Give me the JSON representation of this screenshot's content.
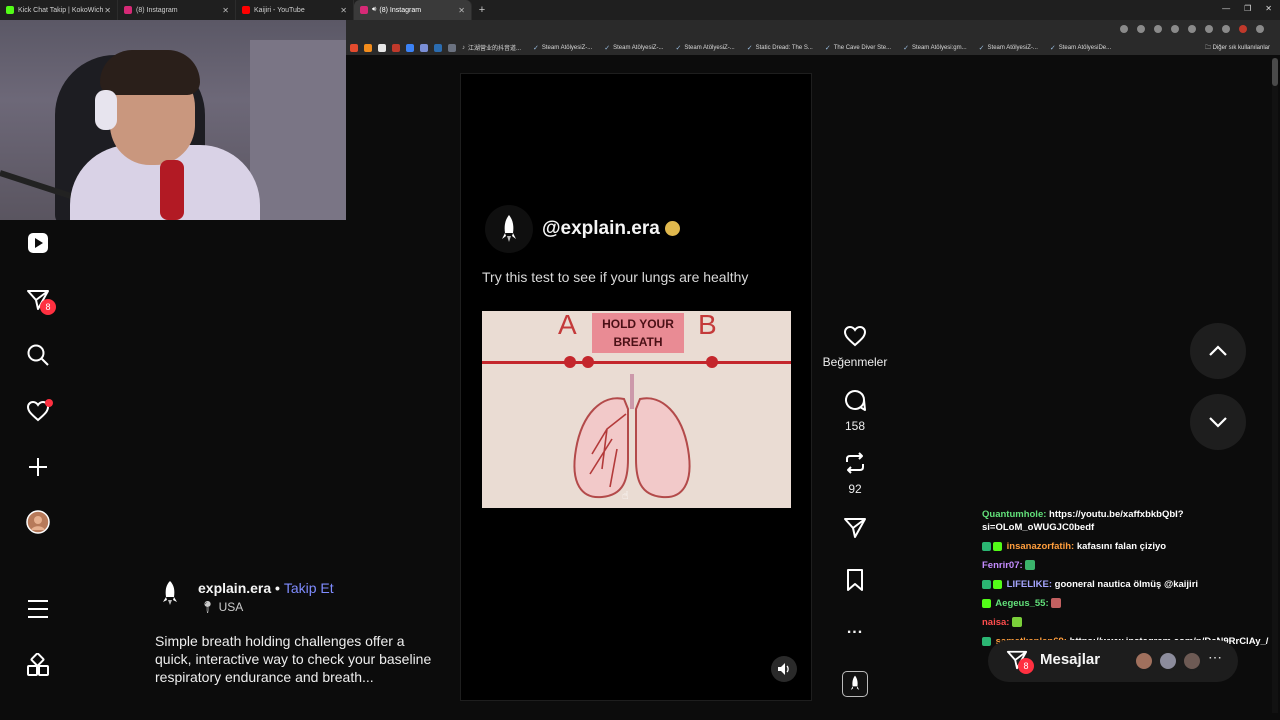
{
  "browser": {
    "tabs": [
      {
        "label": "Kick Chat Takip | KokoWich",
        "active": false,
        "fav_color": "#53fc18"
      },
      {
        "label": "(8) Instagram",
        "active": false,
        "fav_color": "#d62976"
      },
      {
        "label": "Kaijiri - YouTube",
        "active": false,
        "fav_color": "#ff0000"
      },
      {
        "label": "(8) Instagram",
        "active": true,
        "fav_color": "#d62976"
      }
    ],
    "new_tab_glyph": "+",
    "bookmarks": [
      "江湖营业的抖音道...",
      "Steam AtölyesiZ-...",
      "Steam AtölyesiZ-...",
      "Steam AtölyesiZ-...",
      "Static Dread: The S...",
      "The Cave Diver Ste...",
      "Steam Atölyesi:gm...",
      "Steam AtölyesiZ-...",
      "Steam AtölyesiDe..."
    ],
    "other_bookmarks": "Diğer sık kullanılanlar"
  },
  "nav": {
    "reels_badge": "8"
  },
  "post": {
    "username": "explain.era",
    "separator": "•",
    "follow_label": "Takip Et",
    "location": "USA",
    "caption": "Simple breath holding challenges offer a quick, interactive way to check your baseline respiratory endurance and breath..."
  },
  "reel": {
    "handle": "@explain.era",
    "text": "Try this test to see if your lungs are healthy",
    "image": {
      "label_a": "A",
      "label_b": "B",
      "banner": "HOLD YOUR BREATH"
    }
  },
  "actions": {
    "likes_label": "Beğenmeler",
    "comments": "158",
    "reposts": "92",
    "more_glyph": "..."
  },
  "chat": [
    {
      "user": "Quantumhole:",
      "user_color": "#62e07a",
      "text": "https://youtu.be/xaffxbkbQbI?si=OLoM_oWUGJC0bedf",
      "badges": 0
    },
    {
      "user": "insanazorfatih:",
      "user_color": "#ff9e3d",
      "text": "kafasını falan çiziyo",
      "badges": 2
    },
    {
      "user": "Fenrir07:",
      "user_color": "#c48cff",
      "text": "",
      "badges": 0,
      "emote_color": "#3bb36b"
    },
    {
      "user": "LIFELIKE:",
      "user_color": "#a6a6ff",
      "text": "gooneral nautica ölmüş @kaijiri",
      "badges": 2
    },
    {
      "user": "Aegeus_55:",
      "user_color": "#62e07a",
      "text": "",
      "badges": 1,
      "emote_color": "#c26060"
    },
    {
      "user": "naisa:",
      "user_color": "#ff4d4d",
      "text": "",
      "badges": 0,
      "emote_color": "#7bd03a"
    },
    {
      "user": "sametkaplan69:",
      "user_color": "#ff9e3d",
      "text": "https://www.instagram.com/p/DcN9RrClAy_/",
      "badges": 1
    }
  ],
  "messages": {
    "label": "Mesajlar",
    "badge": "8"
  },
  "colors": {
    "badge_red": "#ff3040",
    "follow_blue": "#7f8cff",
    "kick_green": "#53fc18"
  }
}
